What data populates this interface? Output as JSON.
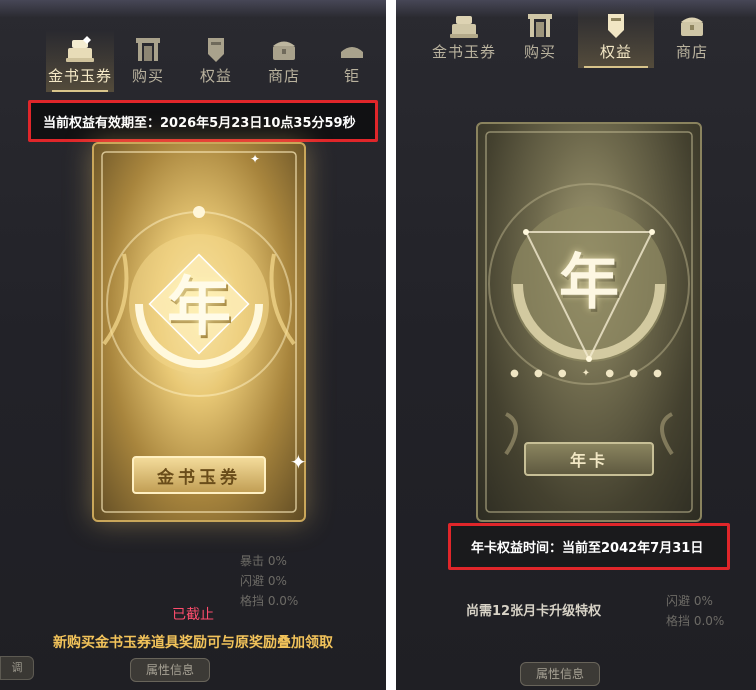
{
  "left_panel": {
    "tabs": [
      {
        "label": "金书玉券",
        "icon": "scroll-chest-icon",
        "active": true
      },
      {
        "label": "购买",
        "icon": "shop-gate-icon",
        "active": false
      },
      {
        "label": "权益",
        "icon": "shield-badge-icon",
        "active": false
      },
      {
        "label": "商店",
        "icon": "treasure-chest-icon",
        "active": false
      },
      {
        "label": "钜",
        "icon": "ingot-icon",
        "active": false
      }
    ],
    "validity_text": "当前权益有效期至：2026年5月23日10点35分59秒",
    "card_char": "年",
    "card_plaque": "金书玉券",
    "expired_text": "已截止",
    "notice_text": "新购买金书玉券道具奖励可与原奖励叠加领取",
    "bottom_button": "属性信息",
    "side_tab": "调",
    "bg_stats": [
      "暴击 0%",
      "闪避 0%",
      "格挡 0.0%"
    ]
  },
  "right_panel": {
    "tabs": [
      {
        "label": "金书玉券",
        "icon": "scroll-chest-icon",
        "active": false
      },
      {
        "label": "购买",
        "icon": "shop-gate-icon",
        "active": false
      },
      {
        "label": "权益",
        "icon": "shield-badge-icon",
        "active": true
      },
      {
        "label": "商店",
        "icon": "treasure-chest-icon",
        "active": false
      }
    ],
    "card_char": "年",
    "card_plaque": "年卡",
    "benefit_time": "年卡权益时间：当前至2042年7月31日",
    "upgrade_text": "尚需12张月卡升级特权",
    "bottom_button": "属性信息",
    "bg_stats": [
      "闪避 0%",
      "格挡 0.0%"
    ]
  },
  "colors": {
    "highlight_box": "#e0262a",
    "gold_text": "#f2c35a",
    "expired_red": "#ff4d6d",
    "tab_text": "#b9b29e"
  }
}
